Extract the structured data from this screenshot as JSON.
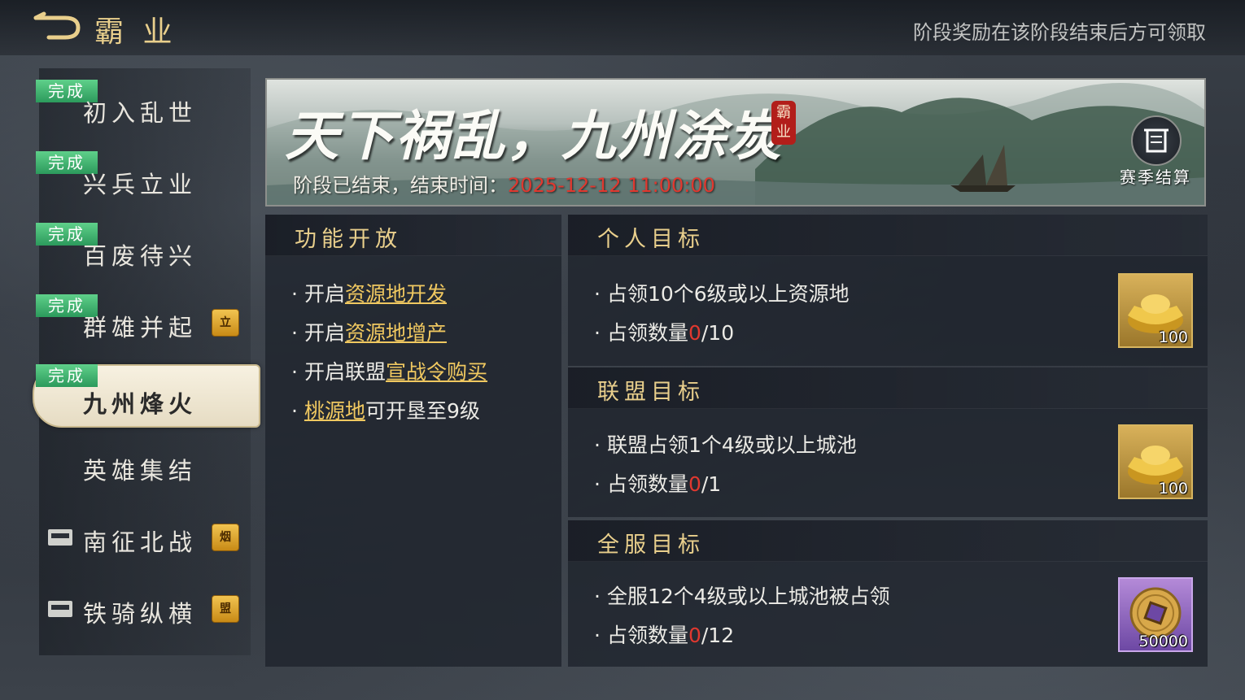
{
  "header": {
    "title": "霸 业",
    "hint": "阶段奖励在该阶段结束后方可领取"
  },
  "sidebar": {
    "items": [
      {
        "label": "初入乱世",
        "badge": "完成"
      },
      {
        "label": "兴兵立业",
        "badge": "完成"
      },
      {
        "label": "百废待兴",
        "badge": "完成"
      },
      {
        "label": "群雄并起",
        "badge": "完成",
        "token": "立"
      },
      {
        "label": "九州烽火",
        "badge": "完成"
      },
      {
        "label": "英雄集结"
      },
      {
        "label": "南征北战",
        "token": "烟"
      },
      {
        "label": "铁骑纵横",
        "token": "盟"
      }
    ],
    "active_index": 4
  },
  "banner": {
    "title": "天下祸乱，九州涂炭",
    "seal": "霸业",
    "status_prefix": "阶段已结束，结束时间：",
    "end_time": "2025-12-12 11:00:00",
    "season_button": "赛季结算"
  },
  "features": {
    "title": "功能开放",
    "lines": [
      {
        "pre": "开启",
        "link": "资源地开发",
        "post": ""
      },
      {
        "pre": "开启",
        "link": "资源地增产",
        "post": ""
      },
      {
        "pre": "开启联盟",
        "link": "宣战令购买",
        "post": ""
      },
      {
        "pre": "",
        "link": "桃源地",
        "post": "可开垦至9级"
      }
    ]
  },
  "goals": {
    "personal": {
      "title": "个人目标",
      "desc": "占领10个6级或以上资源地",
      "progress_label": "占领数量",
      "progress_current": "0",
      "progress_total": "/10",
      "reward_qty": "100"
    },
    "alliance": {
      "title": "联盟目标",
      "desc": "联盟占领1个4级或以上城池",
      "progress_label": "占领数量",
      "progress_current": "0",
      "progress_total": "/1",
      "reward_qty": "100"
    },
    "server": {
      "title": "全服目标",
      "desc": "全服12个4级或以上城池被占领",
      "progress_label": "占领数量",
      "progress_current": "0",
      "progress_total": "/12",
      "reward_qty": "50000"
    }
  },
  "colors": {
    "gold_title": "#e9cf8c",
    "done_green": "#3fb873",
    "warn_red": "#e0382f",
    "link_gold": "#f0c860"
  }
}
